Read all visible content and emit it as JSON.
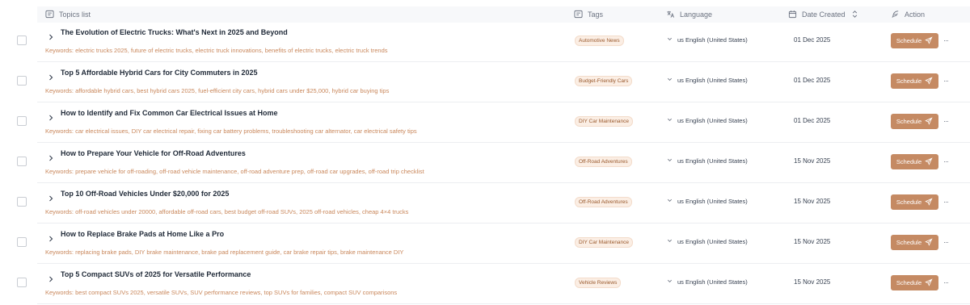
{
  "header": {
    "topics_label": "Topics list",
    "tags_label": "Tags",
    "language_label": "Language",
    "date_label": "Date Created",
    "action_label": "Action"
  },
  "icons": {
    "topics": "list-icon",
    "tags": "tag-icon",
    "language": "translate-icon",
    "date": "calendar-icon",
    "sort": "sort-icon",
    "action": "feather-icon",
    "expand": "chevron-right-icon",
    "lang_dropdown": "chevron-down-icon",
    "send": "send-icon",
    "more": "more-horizontal-icon"
  },
  "colors": {
    "accent": "#c58a63",
    "keywords": "#c9875b",
    "tag_bg": "#fbeee4",
    "tag_text": "#9a5a2e"
  },
  "rows": [
    {
      "title": "The Evolution of Electric Trucks: What's Next in 2025 and Beyond",
      "keywords": "Keywords: electric trucks 2025, future of electric trucks, electric truck innovations, benefits of electric trucks, electric truck trends",
      "tag": "Automotive News",
      "language": "us English (United States)",
      "date": "01 Dec 2025",
      "action": "Schedule",
      "more": "···"
    },
    {
      "title": "Top 5 Affordable Hybrid Cars for City Commuters in 2025",
      "keywords": "Keywords: affordable hybrid cars, best hybrid cars 2025, fuel-efficient city cars, hybrid cars under $25,000, hybrid car buying tips",
      "tag": "Budget-Friendly Cars",
      "language": "us English (United States)",
      "date": "01 Dec 2025",
      "action": "Schedule",
      "more": "···"
    },
    {
      "title": "How to Identify and Fix Common Car Electrical Issues at Home",
      "keywords": "Keywords: car electrical issues, DIY car electrical repair, fixing car battery problems, troubleshooting car alternator, car electrical safety tips",
      "tag": "DIY Car Maintenance",
      "language": "us English (United States)",
      "date": "01 Dec 2025",
      "action": "Schedule",
      "more": "···"
    },
    {
      "title": "How to Prepare Your Vehicle for Off-Road Adventures",
      "keywords": "Keywords: prepare vehicle for off-roading, off-road vehicle maintenance, off-road adventure prep, off-road car upgrades, off-road trip checklist",
      "tag": "Off-Road Adventures",
      "language": "us English (United States)",
      "date": "15 Nov 2025",
      "action": "Schedule",
      "more": "···"
    },
    {
      "title": "Top 10 Off-Road Vehicles Under $20,000 for 2025",
      "keywords": "Keywords: off-road vehicles under 20000, affordable off-road cars, best budget off-road SUVs, 2025 off-road vehicles, cheap 4×4 trucks",
      "tag": "Off-Road Adventures",
      "language": "us English (United States)",
      "date": "15 Nov 2025",
      "action": "Schedule",
      "more": "···"
    },
    {
      "title": "How to Replace Brake Pads at Home Like a Pro",
      "keywords": "Keywords: replacing brake pads, DIY brake maintenance, brake pad replacement guide, car brake repair tips, brake maintenance DIY",
      "tag": "DIY Car Maintenance",
      "language": "us English (United States)",
      "date": "15 Nov 2025",
      "action": "Schedule",
      "more": "···"
    },
    {
      "title": "Top 5 Compact SUVs of 2025 for Versatile Performance",
      "keywords": "Keywords: best compact SUVs 2025, versatile SUVs, SUV performance reviews, top SUVs for families, compact SUV comparisons",
      "tag": "Vehicle Reviews",
      "language": "us English (United States)",
      "date": "15 Nov 2025",
      "action": "Schedule",
      "more": "···"
    }
  ]
}
